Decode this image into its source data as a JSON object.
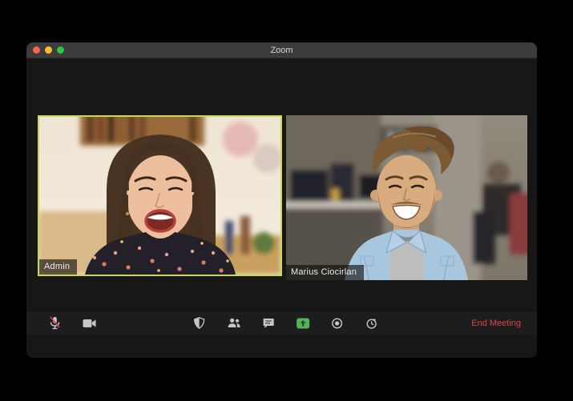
{
  "window": {
    "title": "Zoom",
    "traffic_lights": [
      {
        "name": "close",
        "color": "#ff5f57"
      },
      {
        "name": "minimize",
        "color": "#febc2e"
      },
      {
        "name": "maximize",
        "color": "#28c840"
      }
    ]
  },
  "video_grid": {
    "tiles": [
      {
        "name_label": "Admin",
        "active_speaker": true,
        "scene": "woman-laughing-bright-kitchen"
      },
      {
        "name_label": "Marius Ciocirlan",
        "active_speaker": false,
        "scene": "man-smiling-office-background"
      }
    ]
  },
  "toolbar": {
    "left_icons": [
      {
        "icon": "microphone-muted-icon",
        "action": "unmute"
      },
      {
        "icon": "video-camera-icon",
        "action": "stop-video"
      }
    ],
    "center_icons": [
      {
        "icon": "shield-security-icon",
        "action": "security"
      },
      {
        "icon": "participants-icon",
        "action": "manage-participants"
      },
      {
        "icon": "chat-bubble-icon",
        "action": "chat"
      },
      {
        "icon": "share-screen-icon",
        "action": "share-screen"
      },
      {
        "icon": "record-icon",
        "action": "record"
      },
      {
        "icon": "clock-icon",
        "action": "timer"
      }
    ],
    "end_meeting_label": "End Meeting"
  },
  "colors": {
    "active_speaker_border": "#c8d855",
    "end_meeting_red": "#d9453e",
    "share_screen_green": "#55b157",
    "titlebar_bg": "#3c3c3e",
    "content_bg": "#171717",
    "toolbar_bg": "#1d1d20",
    "icon_gray": "#c6c6ca"
  }
}
